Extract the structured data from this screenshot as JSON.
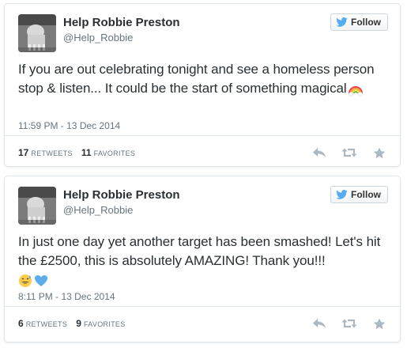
{
  "colors": {
    "text": "#292f33",
    "muted": "#66757f",
    "border": "#e1e8ed",
    "twitter_blue": "#55acee",
    "action_gray": "#aab8c2"
  },
  "follow_icon": "twitter-bird-icon",
  "action_icons": [
    "reply-icon",
    "retweet-icon",
    "favorite-star-icon"
  ],
  "tweets": [
    {
      "user_name": "Help Robbie Preston",
      "user_handle": "@Help_Robbie",
      "follow_label": "Follow",
      "text": "If you are out celebrating tonight and see a homeless person stop & listen... It could be the start of something magical",
      "emojis": [
        "rainbow-emoji"
      ],
      "timestamp": "11:59 PM - 13 Dec 2014",
      "retweets_count": "17",
      "retweets_label": "Retweets",
      "favorites_count": "11",
      "favorites_label": "Favorites"
    },
    {
      "user_name": "Help Robbie Preston",
      "user_handle": "@Help_Robbie",
      "follow_label": "Follow",
      "text": "In just one day yet another target has been smashed! Let's hit the £2500, this is absolutely AMAZING! Thank you!!!",
      "emojis": [
        "smiling-sweat-emoji",
        "blue-heart-emoji"
      ],
      "timestamp": "8:11 PM - 13 Dec 2014",
      "retweets_count": "6",
      "retweets_label": "Retweets",
      "favorites_count": "9",
      "favorites_label": "Favorites"
    }
  ]
}
